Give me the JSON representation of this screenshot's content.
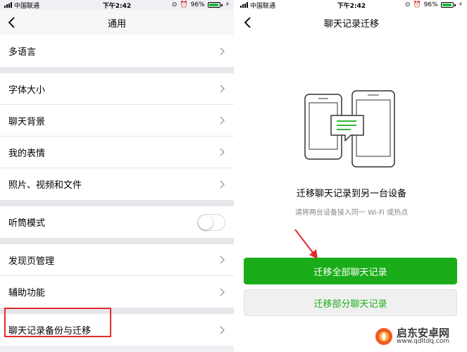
{
  "status_bar": {
    "carrier": "中国联通",
    "time": "下午2:42",
    "battery": "96%",
    "battery_level": 0.96,
    "battery_color": "#1fb83f"
  },
  "left_screen": {
    "title": "通用",
    "groups": [
      [
        {
          "label": "多语言",
          "control": "chevron"
        }
      ],
      [
        {
          "label": "字体大小",
          "control": "chevron"
        },
        {
          "label": "聊天背景",
          "control": "chevron"
        },
        {
          "label": "我的表情",
          "control": "chevron"
        },
        {
          "label": "照片、视频和文件",
          "control": "chevron"
        }
      ],
      [
        {
          "label": "听筒模式",
          "control": "toggle",
          "toggle_on": false
        }
      ],
      [
        {
          "label": "发现页管理",
          "control": "chevron"
        },
        {
          "label": "辅助功能",
          "control": "chevron"
        }
      ],
      [
        {
          "label": "聊天记录备份与迁移",
          "control": "chevron",
          "highlighted": true
        }
      ]
    ],
    "highlight_color": "#e22b2b"
  },
  "right_screen": {
    "title": "聊天记录迁移",
    "heading": "迁移聊天记录到另一台设备",
    "subtitle": "请将两台设备接入同一 Wi-Fi 或热点",
    "primary_button": "迁移全部聊天记录",
    "secondary_button": "迁移部分聊天记录",
    "accent_color": "#1aad19",
    "arrow_color": "#e22b2b"
  },
  "watermark": {
    "name": "启东安卓网",
    "url": "www.qdltdq.com"
  },
  "icons": {
    "back": "chevron-left-icon",
    "row_arrow": "chevron-right-icon",
    "phones": "two-phones-transfer-icon"
  }
}
